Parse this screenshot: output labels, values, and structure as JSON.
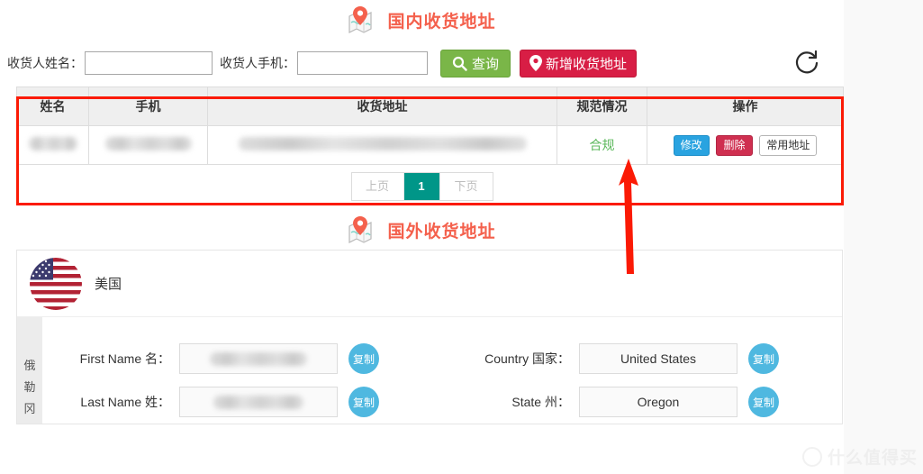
{
  "domestic": {
    "heading": "国内收货地址",
    "heading_icon": "map-pin-icon",
    "search": {
      "name_label": "收货人姓名：",
      "name_value": "",
      "name_placeholder": "",
      "phone_label": "收货人手机：",
      "phone_value": "",
      "phone_placeholder": "",
      "search_button": "查询",
      "search_icon": "search-icon",
      "add_button": "新增收货地址",
      "add_icon": "map-pin-icon",
      "refresh_icon": "refresh-icon"
    },
    "table": {
      "columns": [
        "姓名",
        "手机",
        "收货地址",
        "规范情况",
        "操作"
      ],
      "rows": [
        {
          "name": "",
          "phone": "",
          "address": "",
          "status": "合规",
          "actions": [
            "修改",
            "删除",
            "常用地址"
          ]
        }
      ]
    },
    "pagination": {
      "prev": "上页",
      "current": "1",
      "next": "下页"
    }
  },
  "overseas": {
    "heading": "国外收货地址",
    "heading_icon": "map-pin-icon",
    "country_flag_icon": "us-flag-icon",
    "country_name": "美国",
    "side_strip": [
      "俄",
      "勒",
      "冈"
    ],
    "fields": [
      {
        "label": "First Name 名：",
        "value": "",
        "redacted": true,
        "copy": "复制"
      },
      {
        "label": "Country 国家：",
        "value": "United States",
        "redacted": false,
        "copy": "复制"
      },
      {
        "label": "Last Name 姓：",
        "value": "",
        "redacted": true,
        "copy": "复制"
      },
      {
        "label": "State 州：",
        "value": "Oregon",
        "redacted": false,
        "copy": "复制"
      }
    ]
  },
  "annotation": {
    "box_color": "#fb1a05",
    "arrow_color": "#fb1a05",
    "arrow_target": "合规"
  },
  "watermark": {
    "text": "什么值得买"
  },
  "colors": {
    "accent_red": "#f4604c",
    "search_green": "#7ab648",
    "add_red": "#d81e45",
    "edit_blue": "#29a3e0",
    "delete_red": "#cf2f50",
    "page_active_teal": "#009688",
    "status_green": "#5cb85c",
    "copy_blue": "#4fb8e0"
  }
}
